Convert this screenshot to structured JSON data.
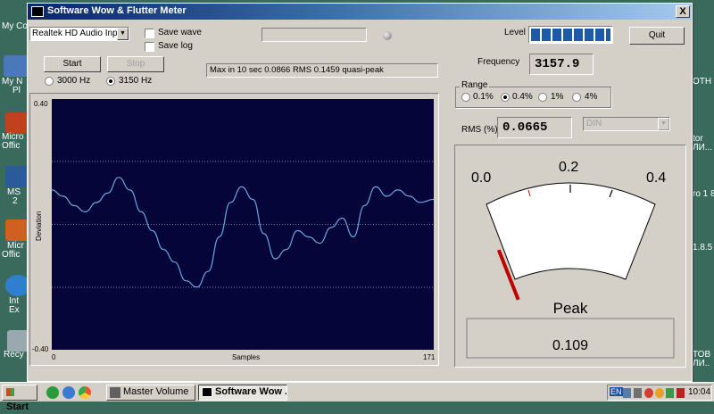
{
  "desktop": {
    "left_labels": [
      "My Co",
      "My N",
      "Pl",
      "Micro",
      "Offic",
      "MS",
      "2",
      "Micr",
      "Offic",
      "Int",
      "Ex",
      "Recy"
    ],
    "right_labels": [
      "OTH",
      "tor",
      "ЛИ...",
      "ro 1 8",
      "1.8.5",
      "ТОВ",
      "ЛИ.."
    ]
  },
  "window": {
    "title": "Software Wow & Flutter Meter",
    "close_label": "X"
  },
  "controls": {
    "device": "Realtek HD Audio Input",
    "save_wave": "Save wave",
    "save_log": "Save log",
    "level_label": "Level",
    "quit": "Quit",
    "start": "Start",
    "stop": "Stop",
    "freq_3000": "3000 Hz",
    "freq_3150": "3150 Hz",
    "status": "Max in 10 sec 0.0866 RMS 0.1459 quasi-peak",
    "frequency_label": "Frequency",
    "frequency_value": "3157.9",
    "range_label": "Range",
    "range_options": [
      "0.1%",
      "0.4%",
      "1%",
      "4%"
    ],
    "rms_label": "RMS (%)",
    "rms_value": "0.0665",
    "weighting": "DIN",
    "level_fraction": 1.0
  },
  "graph": {
    "y_top": "0.40",
    "y_bottom": "-0.40",
    "x_start": "0",
    "x_end": "171",
    "xlabel": "Samples",
    "ylabel": "Deviation"
  },
  "meter": {
    "scale": [
      "0.0",
      "0.2",
      "0.4"
    ],
    "peak_label": "Peak",
    "peak_value": "0.109",
    "min": 0,
    "max": 0.4,
    "value": 0.109
  },
  "chart_data": {
    "type": "line",
    "xlabel": "Samples",
    "ylabel": "Deviation",
    "xlim": [
      0,
      171
    ],
    "ylim": [
      -0.4,
      0.4
    ],
    "series": [
      {
        "x": [
          0,
          5,
          10,
          15,
          20,
          25,
          30,
          35,
          40,
          45,
          50,
          55,
          60,
          65,
          70,
          75,
          80,
          85,
          90,
          95,
          100,
          105,
          110,
          115,
          120,
          125,
          130,
          135,
          140,
          145,
          150,
          155,
          160,
          165,
          171
        ],
        "values": [
          0.11,
          0.09,
          0.06,
          0.04,
          0.07,
          0.1,
          0.15,
          0.11,
          0.04,
          -0.02,
          -0.08,
          -0.12,
          -0.18,
          -0.2,
          -0.15,
          -0.04,
          0.07,
          0.12,
          0.08,
          -0.03,
          -0.11,
          -0.08,
          -0.02,
          -0.04,
          -0.06,
          -0.01,
          0.02,
          -0.04,
          0.06,
          0.12,
          0.09,
          0.11,
          0.09,
          0.07,
          0.08
        ]
      }
    ]
  }
}
